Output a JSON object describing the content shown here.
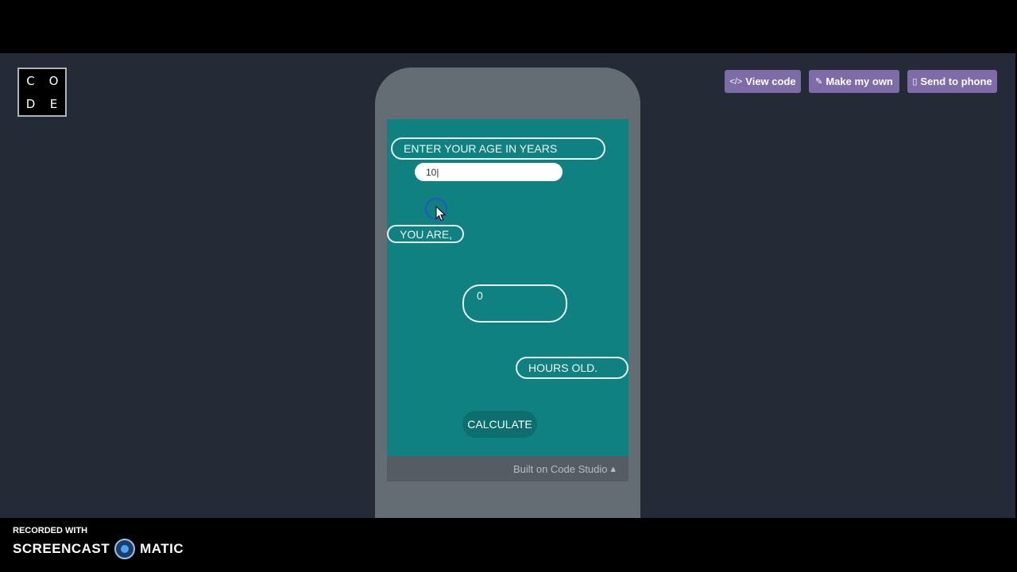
{
  "logo": {
    "letters": [
      "C",
      "O",
      "D",
      "E"
    ]
  },
  "toolbar": {
    "view_code": {
      "icon": "</>",
      "label": "View code"
    },
    "make_my_own": {
      "icon": "✎",
      "label": "Make my own"
    },
    "send_to_phone": {
      "icon": "▯",
      "label": "Send to phone"
    }
  },
  "app": {
    "prompt_label": "ENTER YOUR AGE IN YEARS",
    "age_value": "10|",
    "you_are_label": "YOU ARE,",
    "result_value": "0",
    "hours_label": "HOURS OLD.",
    "calculate_label": "CALCULATE"
  },
  "footer": {
    "label": "Built on Code Studio",
    "caret": "▴"
  },
  "watermark": {
    "line1": "RECORDED WITH",
    "left": "SCREENCAST",
    "right": "MATIC"
  },
  "colors": {
    "accent_button": "#7d6ca8",
    "app_bg": "#0e8180",
    "page_bg": "#242b36"
  }
}
